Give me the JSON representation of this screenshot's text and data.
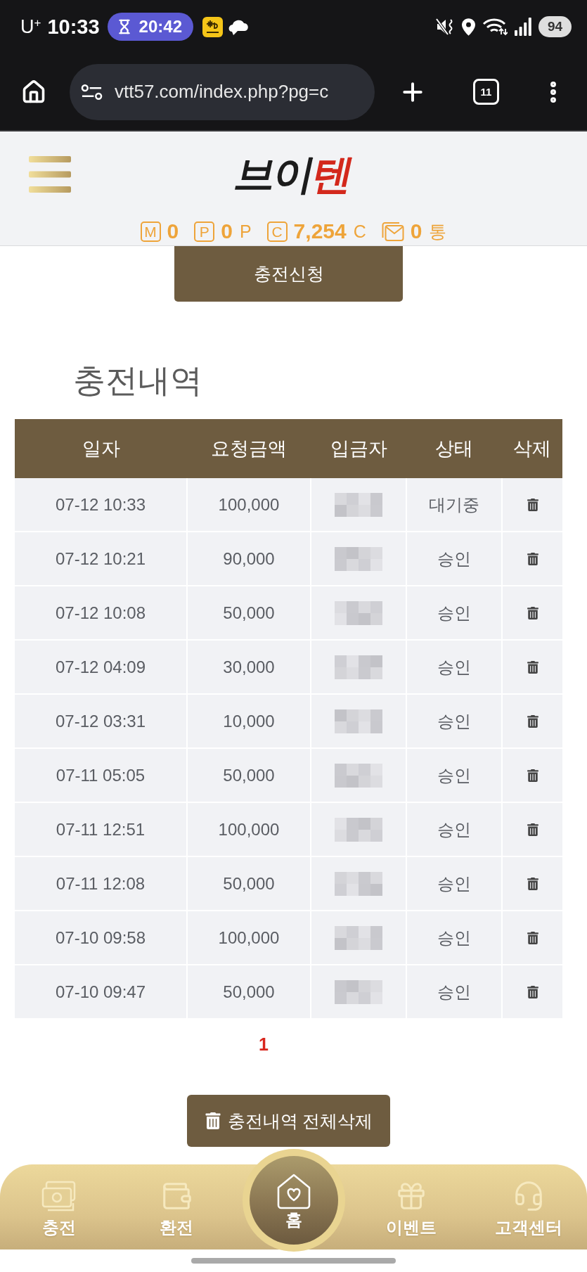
{
  "status_bar": {
    "carrier": "U$^{+}$",
    "time": "10:33",
    "timer": "20:42",
    "battery": "94"
  },
  "browser": {
    "url": "vtt57.com/index.php?pg=c",
    "tab_count": "11"
  },
  "header": {
    "logo": [
      {
        "text": "브이",
        "color": "#1c1c1c"
      },
      {
        "text": "텐",
        "color": "#d3281c"
      }
    ],
    "balances": [
      {
        "kind": "letter",
        "badge": "M",
        "value": "0"
      },
      {
        "kind": "letter",
        "badge": "P",
        "value": "0",
        "unit": "P"
      },
      {
        "kind": "letter",
        "badge": "C",
        "value": "7,254",
        "unit": "C"
      },
      {
        "kind": "mail",
        "value": "0",
        "unit": "통"
      }
    ]
  },
  "request_button": "충전신청",
  "title": "충전내역",
  "table": {
    "columns": [
      "일자",
      "요청금액",
      "입금자",
      "상태",
      "삭제"
    ],
    "rows": [
      {
        "date": "07-12 10:33",
        "amount": "100,000",
        "status": "대기중"
      },
      {
        "date": "07-12 10:21",
        "amount": "90,000",
        "status": "승인"
      },
      {
        "date": "07-12 10:08",
        "amount": "50,000",
        "status": "승인"
      },
      {
        "date": "07-12 04:09",
        "amount": "30,000",
        "status": "승인"
      },
      {
        "date": "07-12 03:31",
        "amount": "10,000",
        "status": "승인"
      },
      {
        "date": "07-11 05:05",
        "amount": "50,000",
        "status": "승인"
      },
      {
        "date": "07-11 12:51",
        "amount": "100,000",
        "status": "승인"
      },
      {
        "date": "07-11 12:08",
        "amount": "50,000",
        "status": "승인"
      },
      {
        "date": "07-10 09:58",
        "amount": "100,000",
        "status": "승인"
      },
      {
        "date": "07-10 09:47",
        "amount": "50,000",
        "status": "승인"
      }
    ]
  },
  "pagination": [
    {
      "label": "1",
      "selected": true
    }
  ],
  "delete_all_button": "충전내역 전체삭제",
  "bottom_nav": [
    {
      "kind": "charge",
      "label": "충전"
    },
    {
      "kind": "exchange",
      "label": "환전"
    },
    {
      "kind": "home",
      "label": "홈"
    },
    {
      "kind": "event",
      "label": "이벤트"
    },
    {
      "kind": "support",
      "label": "고객센터"
    }
  ]
}
